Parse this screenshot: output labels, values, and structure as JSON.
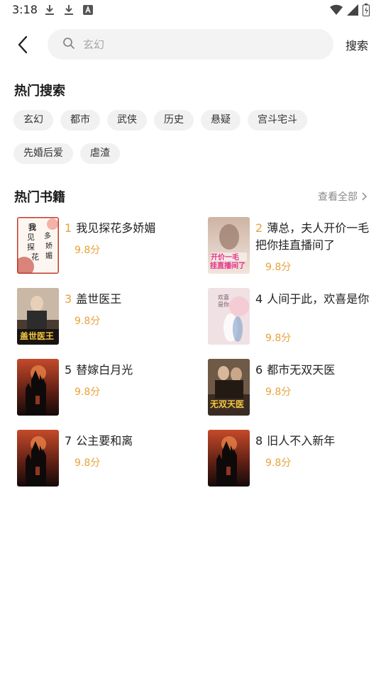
{
  "status": {
    "time": "3:18"
  },
  "search": {
    "placeholder": "玄幻",
    "button": "搜索"
  },
  "hot_search": {
    "title": "热门搜索",
    "tags": [
      "玄幻",
      "都市",
      "武侠",
      "历史",
      "悬疑",
      "宫斗宅斗",
      "先婚后爱",
      "虐渣"
    ]
  },
  "hot_books": {
    "title": "热门书籍",
    "view_all": "查看全部",
    "books": [
      {
        "rank": "1",
        "title": "我见探花多娇媚",
        "score": "9.8分",
        "cover_text": "我见探花多娇媚"
      },
      {
        "rank": "2",
        "title": "薄总，夫人开价一毛把你挂直播间了",
        "score": "9.8分",
        "cover_text": "开价一毛 挂直播间了"
      },
      {
        "rank": "3",
        "title": "盖世医王",
        "score": "9.8分",
        "cover_text": "盖世医王"
      },
      {
        "rank": "4",
        "title": "人间于此，欢喜是你",
        "score": "9.8分",
        "cover_text": "欢喜是你"
      },
      {
        "rank": "5",
        "title": "替嫁白月光",
        "score": "9.8分",
        "cover_text": ""
      },
      {
        "rank": "6",
        "title": "都市无双天医",
        "score": "9.8分",
        "cover_text": "无双天医"
      },
      {
        "rank": "7",
        "title": "公主要和离",
        "score": "9.8分",
        "cover_text": ""
      },
      {
        "rank": "8",
        "title": "旧人不入新年",
        "score": "9.8分",
        "cover_text": ""
      }
    ]
  },
  "colors": {
    "accent": "#e8a23a",
    "tag_bg": "#f1f1f1",
    "search_bg": "#f3f3f3"
  }
}
